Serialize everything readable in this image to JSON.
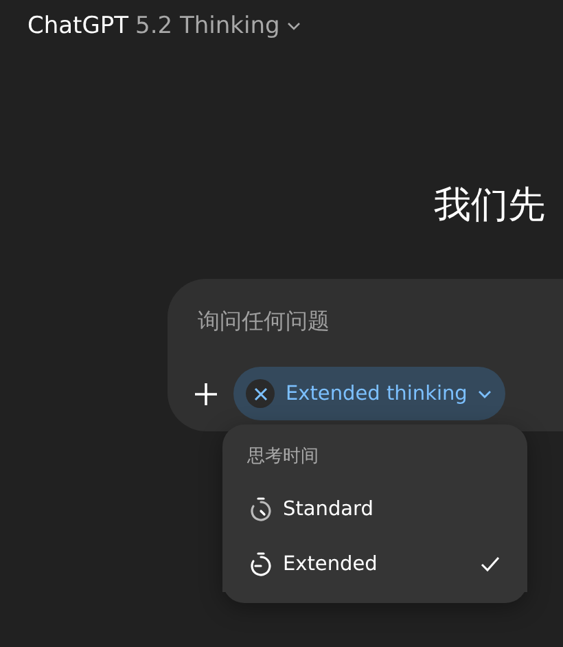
{
  "header": {
    "app_name": "ChatGPT",
    "model": "5.2 Thinking"
  },
  "heading": "我们先",
  "composer": {
    "placeholder": "询问任何问题",
    "chip": {
      "label": "Extended thinking"
    }
  },
  "menu": {
    "title": "思考时间",
    "items": [
      {
        "label": "Standard",
        "kind": "standard",
        "selected": false
      },
      {
        "label": "Extended",
        "kind": "extended",
        "selected": true
      }
    ]
  }
}
